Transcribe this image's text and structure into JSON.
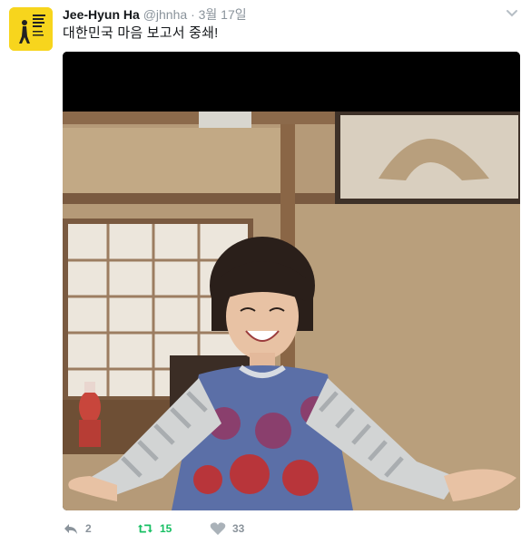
{
  "tweet": {
    "author_name": "Jee-Hyun Ha",
    "handle": "@jhnha",
    "separator": "·",
    "time": "3월 17일",
    "text": "대한민국 마음 보고서 중쇄!",
    "avatar_icon": "yellow-book-cover-avatar",
    "photo_description_icon": "woman-smiling-arms-outstretched-photo"
  },
  "actions": {
    "reply_icon": "reply-icon",
    "reply_count": "2",
    "retweet_icon": "retweet-icon",
    "retweet_count": "15",
    "like_icon": "heart-icon",
    "like_count": "33"
  },
  "colors": {
    "retweet_active": "#17bf63",
    "muted": "#8a939b",
    "avatar_bg": "#f7d51d"
  }
}
